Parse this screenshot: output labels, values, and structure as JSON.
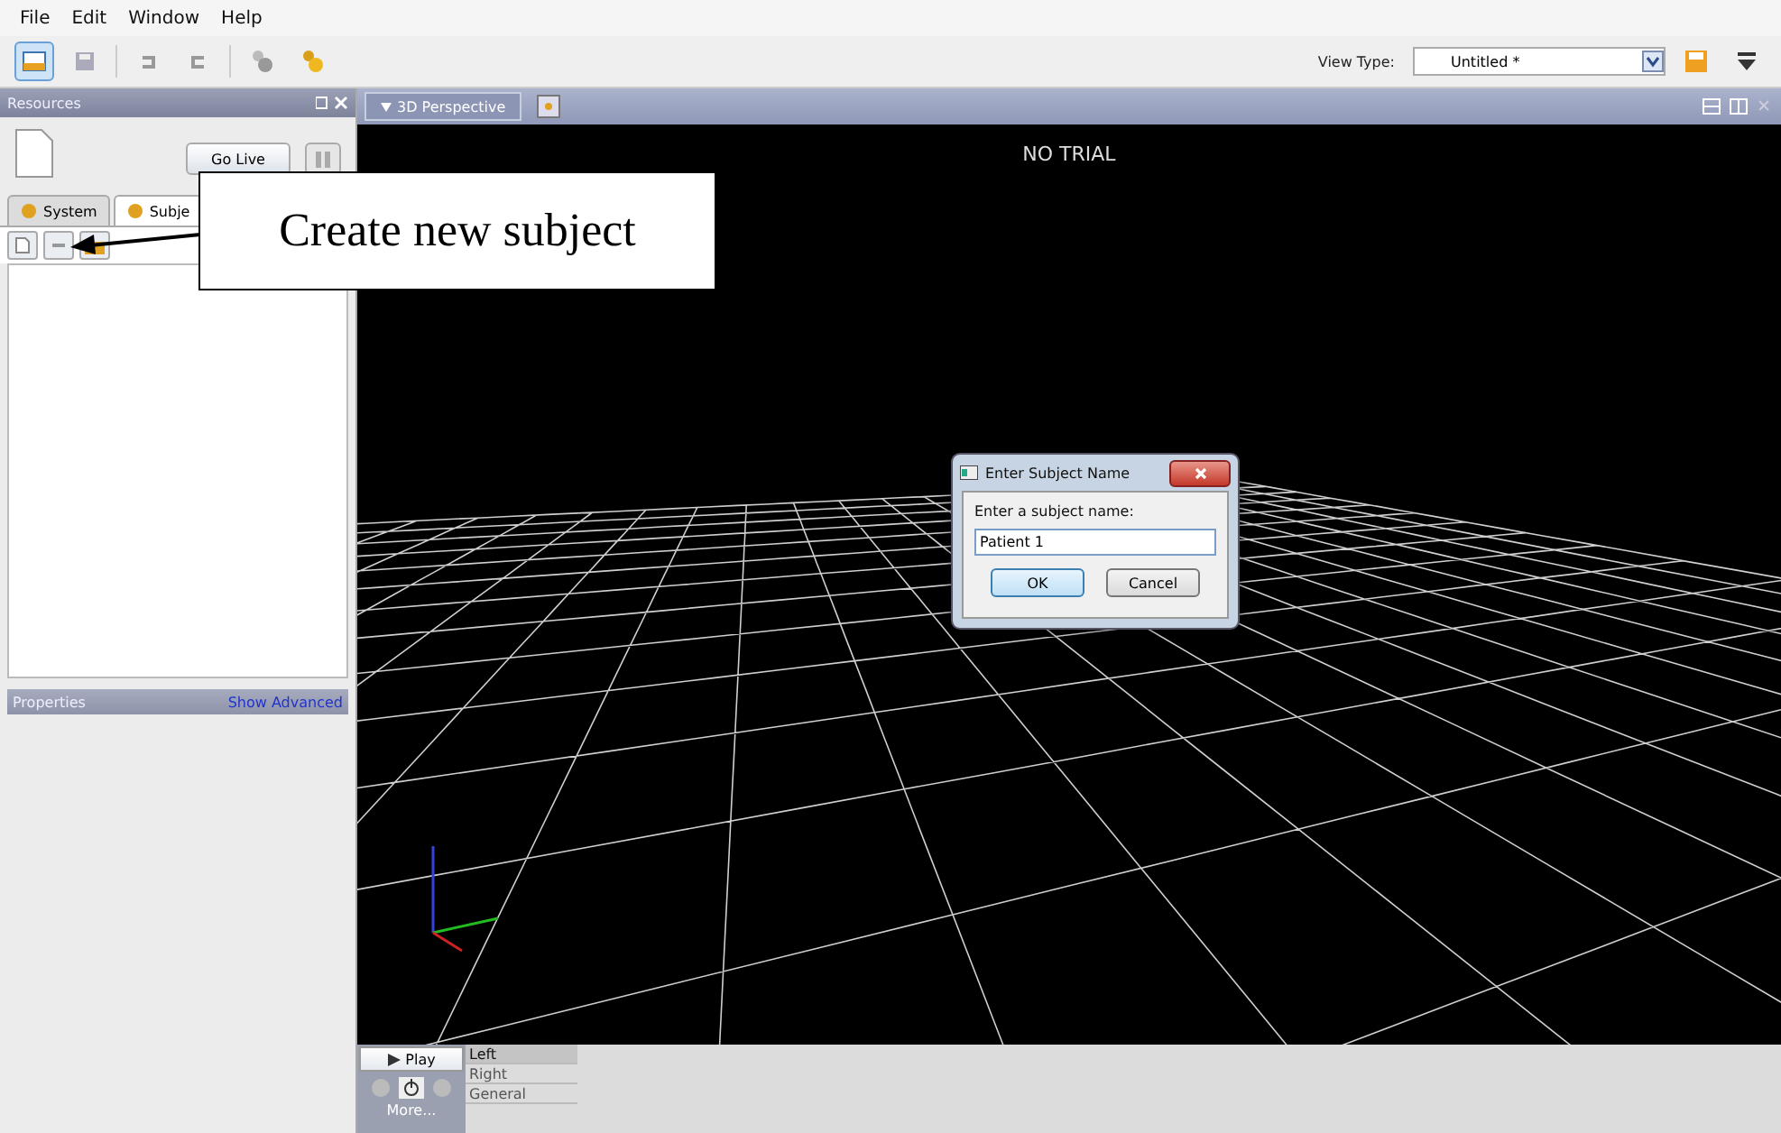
{
  "menu": [
    "File",
    "Edit",
    "Window",
    "Help"
  ],
  "view_type": {
    "label": "View Type:",
    "value": "Untitled *"
  },
  "resources_panel": {
    "title": "Resources",
    "go_live": "Go Live",
    "tabs": [
      {
        "label": "System",
        "selected": false
      },
      {
        "label": "Subje",
        "selected": true
      }
    ]
  },
  "properties_panel": {
    "title": "Properties",
    "link": "Show Advanced"
  },
  "viewport": {
    "tab": "3D Perspective",
    "overlay": "NO TRIAL"
  },
  "dialog": {
    "title": "Enter Subject Name",
    "prompt": "Enter a subject name:",
    "value": "Patient 1",
    "buttons": [
      "OK",
      "Cancel"
    ]
  },
  "playback": {
    "play": "Play",
    "views": [
      {
        "label": "Left",
        "selected": true
      },
      {
        "label": "Right",
        "selected": false
      },
      {
        "label": "General",
        "selected": false
      }
    ],
    "more": "More..."
  },
  "callout": "Create new subject"
}
